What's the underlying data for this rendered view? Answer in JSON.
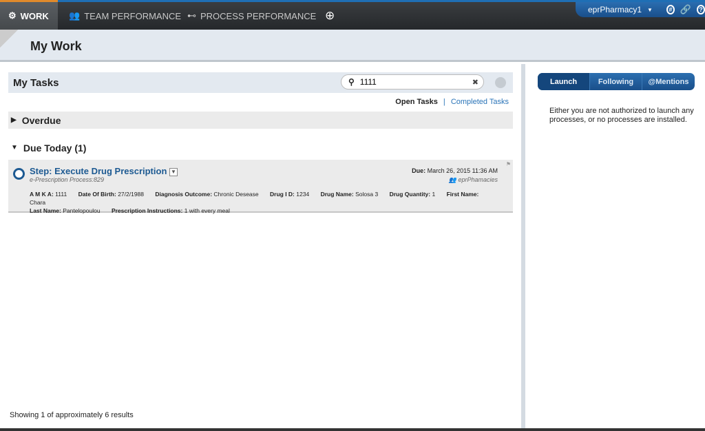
{
  "nav": {
    "items": [
      {
        "label": "WORK",
        "icon": "gear-icon"
      },
      {
        "label": "TEAM PERFORMANCE",
        "icon": "team-icon"
      },
      {
        "label": "PROCESS PERFORMANCE",
        "icon": "process-icon"
      }
    ],
    "add_icon": "plus-circle-icon",
    "user": "eprPharmacy1",
    "icons": [
      "globe-icon",
      "link-icon",
      "help-icon"
    ]
  },
  "header": {
    "title": "My Work"
  },
  "tasks": {
    "title": "My Tasks",
    "search_value": "1111",
    "open_tasks": "Open Tasks",
    "separator": "|",
    "completed_tasks": "Completed Tasks",
    "overdue": "Overdue",
    "due_today": "Due Today (1)",
    "task": {
      "title": "Step: Execute Drug Prescription",
      "process": "e-Prescription Process:829",
      "due_label": "Due:",
      "due_value": "March 26, 2015 11:36 AM",
      "team": "eprPhamacies",
      "fields": [
        {
          "k": "A M K A:",
          "v": "1111"
        },
        {
          "k": "Date Of Birth:",
          "v": "27/2/1988"
        },
        {
          "k": "Diagnosis Outcome:",
          "v": "Chronic Desease"
        },
        {
          "k": "Drug I D:",
          "v": "1234"
        },
        {
          "k": "Drug Name:",
          "v": "Solosa 3"
        },
        {
          "k": "Drug Quantity:",
          "v": "1"
        },
        {
          "k": "First Name:",
          "v": "Chara"
        },
        {
          "k": "Last Name:",
          "v": "Pantelopoulou"
        },
        {
          "k": "Prescription Instructions:",
          "v": "1 with every meal"
        }
      ]
    },
    "footer": "Showing 1 of approximately 6 results"
  },
  "right": {
    "tabs": [
      "Launch",
      "Following",
      "@Mentions"
    ],
    "message": "Either you are not authorized to launch any processes, or no processes are installed."
  }
}
